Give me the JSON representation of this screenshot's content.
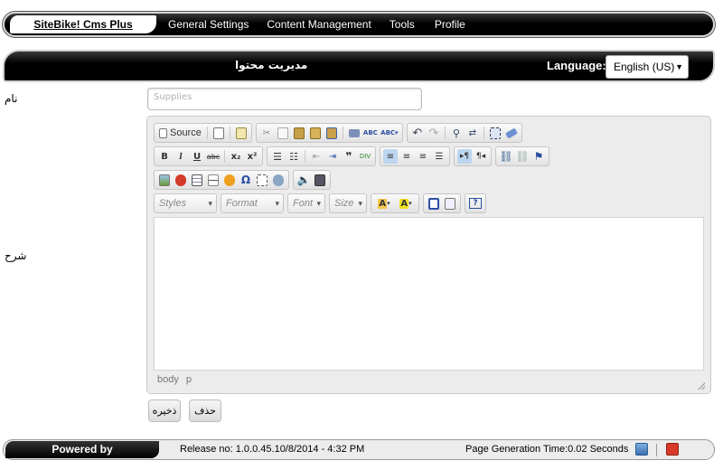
{
  "topbar": {
    "brand": "SiteBike! Cms Plus",
    "nav": [
      "General Settings",
      "Content Management",
      "Tools",
      "Profile"
    ]
  },
  "header": {
    "title": "مدیریت محتوا",
    "language_label": "Language:",
    "language_value": "English (US)"
  },
  "form": {
    "name_label": "نام",
    "name_value": "Supplies",
    "description_label": "شرح"
  },
  "editor": {
    "source_label": "Source",
    "combos": [
      "Styles",
      "Format",
      "Font",
      "Size"
    ],
    "bold": "B",
    "italic": "I",
    "underline": "U",
    "strike": "abc",
    "subscript": "x₂",
    "superscript": "x²",
    "path": "body p"
  },
  "actions": {
    "save": "ذخیره",
    "delete": "حذف"
  },
  "footer": {
    "powered": "Powered by",
    "release": "Release no: 1.0.0.45.10/8/2014 - 4:32 PM",
    "page_time": "Page Generation Time:0.02  Seconds"
  },
  "colors": {
    "bar_dark": "#000000",
    "toolbar_bg": "#ececec",
    "active_blue": "#bcd6f0"
  }
}
